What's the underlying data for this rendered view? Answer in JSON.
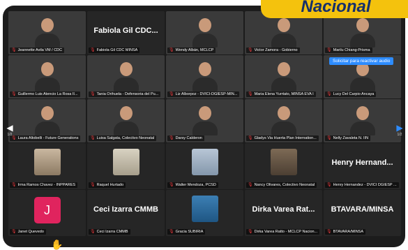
{
  "banner": {
    "text": "Nacional"
  },
  "pagination": {
    "left_page": "1/2",
    "right_page": "1/2"
  },
  "audio_prompt": "Solicitar para reactivar audio",
  "rows": [
    [
      {
        "label": "Jeannette Avila VM / CDC",
        "kind": "video",
        "bg": "bgA"
      },
      {
        "label": "Fabiola Gil CDC MINSA",
        "kind": "name",
        "big": "Fabiola Gil CDC..."
      },
      {
        "label": "Wendy Albán, MCLCP",
        "kind": "video",
        "bg": "bgD"
      },
      {
        "label": "Victor Zamora - Gobierno",
        "kind": "video",
        "bg": "bgF"
      },
      {
        "label": "Marilu Chiang-Prisma",
        "kind": "video",
        "bg": "bgB"
      }
    ],
    [
      {
        "label": "Guillermo Luis Atencio La Rosa II...",
        "kind": "video",
        "bg": "bgE"
      },
      {
        "label": "Tania Orihuela - Defensoria del Pu...",
        "kind": "video",
        "bg": "bgC"
      },
      {
        "label": "Liz Alborpoz - DVICI-DGIESP-MIN...",
        "kind": "video",
        "bg": "bgG"
      },
      {
        "label": "Maria Elena Yurrtato, MINSA EVA I",
        "kind": "video",
        "bg": "bgB"
      },
      {
        "label": "Lucy Del Carpio Ancaya",
        "kind": "video",
        "bg": "bgD",
        "audio": true
      }
    ],
    [
      {
        "label": "Laura Altobelli - Future Generations",
        "kind": "video",
        "bg": "bgC"
      },
      {
        "label": "Luisa Salgata, Colectivo Neonatal",
        "kind": "video",
        "bg": "bgF"
      },
      {
        "label": "Darsy Calderon",
        "kind": "video",
        "bg": "bgG"
      },
      {
        "label": "Gladys Via Huerta Plan Internation...",
        "kind": "video",
        "bg": "bgH"
      },
      {
        "label": "Nelly Zavaleta N. IIN",
        "kind": "video",
        "bg": "bgF"
      }
    ],
    [
      {
        "label": "Irma Ramos Chavez - INPPARES",
        "kind": "photo",
        "bg": "bgH"
      },
      {
        "label": "Raquel Hurtado",
        "kind": "photo",
        "bg": "bgF"
      },
      {
        "label": "Walter Mendoza, PCSD",
        "kind": "photo",
        "bg": "bgD"
      },
      {
        "label": "Nancy Olivares, Colectivo Neonatal",
        "kind": "photo",
        "bg": "bgC"
      },
      {
        "label": "Henry Hernandez - DVICI DGIESP ...",
        "kind": "name",
        "big": "Henry Hernand..."
      }
    ],
    [
      {
        "label": "Janet Quevedo",
        "kind": "initial",
        "initial": "J"
      },
      {
        "label": "Ceci Izarra CMMB",
        "kind": "name",
        "big": "Ceci Izarra CMMB"
      },
      {
        "label": "Gracia SUBIRIA",
        "kind": "photo",
        "bg": "bgE"
      },
      {
        "label": "Dirka Varea Ratto - MCLCP Nacion...",
        "kind": "name",
        "big": "Dirka Varea Rat..."
      },
      {
        "label": "BTAVARA/MINSA",
        "kind": "name",
        "big": "BTAVARA/MINSA"
      }
    ]
  ],
  "colors": {
    "banner": "#f4c20d",
    "banner_text": "#16306b",
    "muted_mic": "#e5383b",
    "accent": "#2d8cff",
    "initial_avatar": "#e0245e"
  }
}
